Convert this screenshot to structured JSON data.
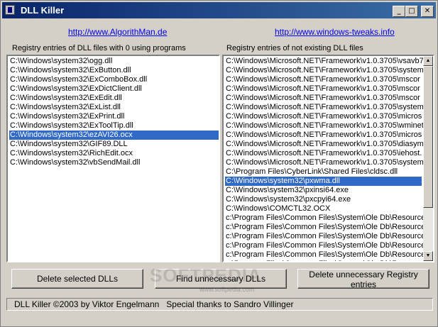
{
  "window": {
    "title": "DLL Killer"
  },
  "links": {
    "left": "http://www.AlgorithMan.de",
    "right": "http://www.windows-tweaks.info"
  },
  "panels": {
    "left_label": "Registry entries of DLL files with 0 using programs",
    "right_label": "Registry entries of not existing DLL files"
  },
  "left_list": [
    "C:\\Windows\\system32\\ogg.dll",
    "C:\\Windows\\system32\\ExButton.dll",
    "C:\\Windows\\system32\\ExComboBox.dll",
    "C:\\Windows\\system32\\ExDictClient.dll",
    "C:\\Windows\\system32\\ExEdit.dll",
    "C:\\Windows\\system32\\ExList.dll",
    "C:\\Windows\\system32\\ExPrint.dll",
    "C:\\Windows\\system32\\ExToolTip.dll",
    "C:\\Windows\\system32\\ezAVI26.ocx",
    "C:\\Windows\\system32\\GIF89.DLL",
    "C:\\Windows\\system32\\RichEdit.ocx",
    "C:\\Windows\\system32\\vbSendMail.dll"
  ],
  "left_selected_index": 8,
  "right_list": [
    "C:\\Windows\\Microsoft.NET\\Framework\\v1.0.3705\\vsavb7",
    "C:\\Windows\\Microsoft.NET\\Framework\\v1.0.3705\\system",
    "C:\\Windows\\Microsoft.NET\\Framework\\v1.0.3705\\mscor",
    "C:\\Windows\\Microsoft.NET\\Framework\\v1.0.3705\\mscor",
    "C:\\Windows\\Microsoft.NET\\Framework\\v1.0.3705\\mscor",
    "C:\\Windows\\Microsoft.NET\\Framework\\v1.0.3705\\system",
    "C:\\Windows\\Microsoft.NET\\Framework\\v1.0.3705\\micros",
    "C:\\Windows\\Microsoft.NET\\Framework\\v1.0.3705\\wminet",
    "C:\\Windows\\Microsoft.NET\\Framework\\v1.0.3705\\micros",
    "C:\\Windows\\Microsoft.NET\\Framework\\v1.0.3705\\diasym",
    "C:\\Windows\\Microsoft.NET\\Framework\\v1.0.3705\\iehost.",
    "C:\\Windows\\Microsoft.NET\\Framework\\v1.0.3705\\system",
    "C:\\Program Files\\CyberLink\\Shared Files\\cldsc.dll",
    "C:\\Windows\\system32\\pxwma.dll",
    "C:\\Windows\\system32\\pxinsi64.exe",
    "C:\\Windows\\system32\\pxcpyi64.exe",
    "C:\\Windows\\COMCTL32.OCX",
    "c:\\Program Files\\Common Files\\System\\Ole Db\\Resources",
    "c:\\Program Files\\Common Files\\System\\Ole Db\\Resources",
    "c:\\Program Files\\Common Files\\System\\Ole Db\\Resources",
    "c:\\Program Files\\Common Files\\System\\Ole Db\\Resources",
    "c:\\Program Files\\Common Files\\System\\Ole Db\\Resources",
    "c:\\Program Files\\Common Files\\System\\Ole Db\\Resources"
  ],
  "right_selected_index": 13,
  "buttons": {
    "delete_selected": "Delete selected DLLs",
    "find": "Find unnecessary DLLs",
    "delete_registry": "Delete unnecessary Registry entries"
  },
  "watermark": {
    "main": "SOFTPEDIA",
    "sub": "www.softpedia.com"
  },
  "status": "DLL Killer ©2003 by Viktor Engelmann   Special thanks to Sandro Villinger",
  "icons": {
    "app": "app-icon",
    "minimize": "minimize-icon",
    "maximize": "maximize-icon",
    "close": "close-icon"
  }
}
